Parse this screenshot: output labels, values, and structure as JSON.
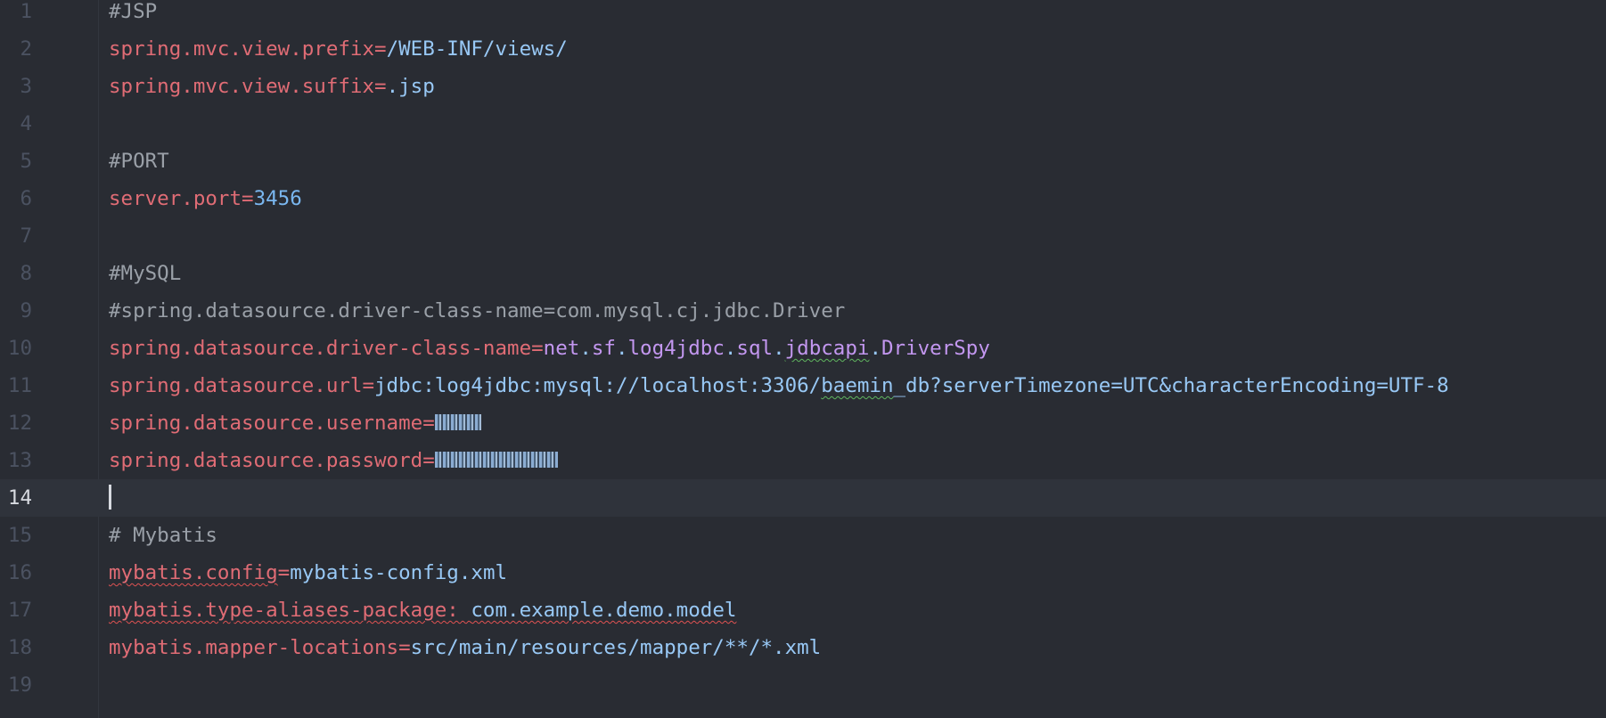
{
  "editor": {
    "active_line": 14,
    "lines": [
      {
        "num": "1",
        "tokens": [
          {
            "type": "comment",
            "text": "#JSP"
          }
        ]
      },
      {
        "num": "2",
        "tokens": [
          {
            "type": "key",
            "text": "spring.mvc.view.prefix="
          },
          {
            "type": "val",
            "text": "/WEB-INF/views/"
          }
        ]
      },
      {
        "num": "3",
        "tokens": [
          {
            "type": "key",
            "text": "spring.mvc.view.suffix="
          },
          {
            "type": "val",
            "text": ".jsp"
          }
        ]
      },
      {
        "num": "4",
        "tokens": []
      },
      {
        "num": "5",
        "tokens": [
          {
            "type": "comment",
            "text": "#PORT"
          }
        ]
      },
      {
        "num": "6",
        "tokens": [
          {
            "type": "key",
            "text": "server.port="
          },
          {
            "type": "num",
            "text": "3456"
          }
        ]
      },
      {
        "num": "7",
        "tokens": []
      },
      {
        "num": "8",
        "tokens": [
          {
            "type": "comment",
            "text": "#MySQL"
          }
        ]
      },
      {
        "num": "9",
        "tokens": [
          {
            "type": "comment",
            "text": "#spring.datasource.driver-class-name=com.mysql.cj.jdbc.Driver"
          }
        ]
      },
      {
        "num": "10",
        "tokens": [
          {
            "type": "key",
            "text": "spring.datasource.driver-class-name="
          },
          {
            "type": "class",
            "text": "net"
          },
          {
            "type": "val",
            "text": "."
          },
          {
            "type": "class",
            "text": "sf"
          },
          {
            "type": "val",
            "text": "."
          },
          {
            "type": "class",
            "text": "log4jdbc"
          },
          {
            "type": "val",
            "text": "."
          },
          {
            "type": "class",
            "text": "sql"
          },
          {
            "type": "val",
            "text": "."
          },
          {
            "type": "class",
            "text": "jdbcapi",
            "squiggle": "green"
          },
          {
            "type": "val",
            "text": "."
          },
          {
            "type": "class",
            "text": "DriverSpy"
          }
        ]
      },
      {
        "num": "11",
        "tokens": [
          {
            "type": "key",
            "text": "spring.datasource.url="
          },
          {
            "type": "val",
            "text": "jdbc:log4jdbc:mysql://localhost:3306/"
          },
          {
            "type": "val",
            "text": "baemin",
            "squiggle": "green"
          },
          {
            "type": "val",
            "text": "_db?serverTimezone=UTC&characterEncoding=UTF-8"
          }
        ]
      },
      {
        "num": "12",
        "tokens": [
          {
            "type": "key",
            "text": "spring.datasource.username="
          },
          {
            "type": "masked",
            "text": "",
            "size": "user"
          }
        ]
      },
      {
        "num": "13",
        "tokens": [
          {
            "type": "key",
            "text": "spring.datasource.password="
          },
          {
            "type": "masked",
            "text": "",
            "size": "pass"
          }
        ]
      },
      {
        "num": "14",
        "tokens": [
          {
            "type": "cursor",
            "text": ""
          }
        ]
      },
      {
        "num": "15",
        "tokens": [
          {
            "type": "comment",
            "text": "# Mybatis"
          }
        ]
      },
      {
        "num": "16",
        "tokens": [
          {
            "type": "key",
            "text": "mybatis.config",
            "squiggle": "red"
          },
          {
            "type": "key",
            "text": "="
          },
          {
            "type": "val",
            "text": "mybatis-config.xml"
          }
        ]
      },
      {
        "num": "17",
        "tokens": [
          {
            "type": "key",
            "text": "mybatis.type-aliases-package: ",
            "squiggle": "red"
          },
          {
            "type": "val",
            "text": "com.example.demo.model",
            "squiggle": "red"
          }
        ]
      },
      {
        "num": "18",
        "tokens": [
          {
            "type": "key",
            "text": "mybatis.mapper-locations="
          },
          {
            "type": "val",
            "text": "src/main/resources/mapper/**/*.xml"
          }
        ]
      },
      {
        "num": "19",
        "tokens": []
      }
    ]
  },
  "colors": {
    "background": "#292c33",
    "active_line": "#2f333b",
    "comment": "#9aa0a8",
    "key": "#e06c75",
    "value": "#98c8f5",
    "class": "#c397f0",
    "number": "#7ab7f0"
  }
}
